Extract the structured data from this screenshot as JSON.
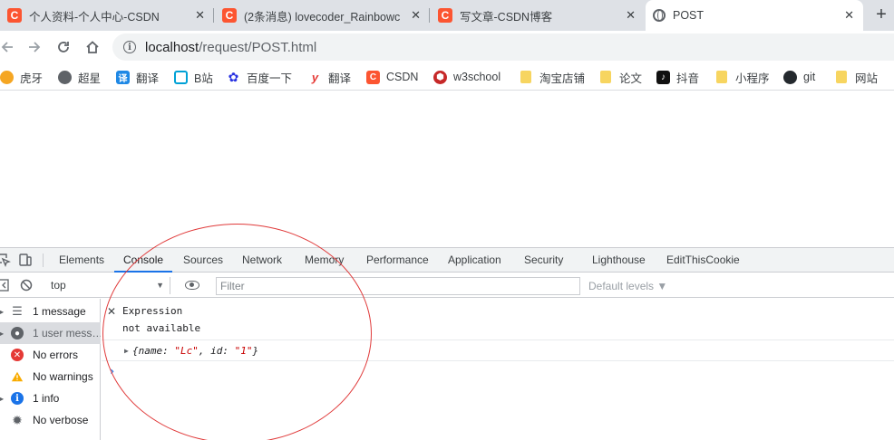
{
  "tabs": [
    {
      "title": "个人资料-个人中心-CSDN",
      "favicon": "csdn-icon",
      "active": false
    },
    {
      "title": "(2条消息) lovecoder_Rainbowc",
      "favicon": "csdn-icon",
      "active": false
    },
    {
      "title": "写文章-CSDN博客",
      "favicon": "csdn-icon",
      "active": false
    },
    {
      "title": "POST",
      "favicon": "globe-icon",
      "active": true
    }
  ],
  "tab_close_glyph": "✕",
  "new_tab_glyph": "+",
  "address": {
    "host": "localhost",
    "path": "/request/POST.html"
  },
  "bookmarks": [
    {
      "label": "虎牙",
      "icon": "huya-icon",
      "color": "#f5a623",
      "glyph": "虎"
    },
    {
      "label": "超星",
      "icon": "globe-icon",
      "color": "#5f6368",
      "glyph": "◉"
    },
    {
      "label": "翻译",
      "icon": "translate-icon",
      "color": "#1e88e5",
      "glyph": "译"
    },
    {
      "label": "B站",
      "icon": "bilibili-icon",
      "color": "#00a1d6",
      "glyph": "▣"
    },
    {
      "label": "百度一下",
      "icon": "baidu-icon",
      "color": "#2932e1",
      "glyph": "✿"
    },
    {
      "label": "翻译",
      "icon": "youdao-icon",
      "color": "#e53935",
      "glyph": "y"
    },
    {
      "label": "CSDN",
      "icon": "csdn-icon",
      "color": "#fc5531",
      "glyph": "C"
    },
    {
      "label": "w3school",
      "icon": "w3school-icon",
      "color": "#c62828",
      "glyph": "⬢"
    },
    {
      "label": "淘宝店铺",
      "icon": "folder-icon",
      "color": "#f7d560",
      "glyph": ""
    },
    {
      "label": "论文",
      "icon": "folder-icon",
      "color": "#f7d560",
      "glyph": ""
    },
    {
      "label": "抖音",
      "icon": "douyin-icon",
      "color": "#111111",
      "glyph": "♪"
    },
    {
      "label": "小程序",
      "icon": "folder-icon",
      "color": "#f7d560",
      "glyph": ""
    },
    {
      "label": "git",
      "icon": "github-icon",
      "color": "#24292e",
      "glyph": "●"
    },
    {
      "label": "网站",
      "icon": "folder-icon",
      "color": "#f7d560",
      "glyph": ""
    }
  ],
  "devtools": {
    "tabs": [
      "Elements",
      "Console",
      "Sources",
      "Network",
      "Memory",
      "Performance",
      "Application",
      "Security",
      "Lighthouse",
      "EditThisCookie"
    ],
    "active_tab": "Console",
    "context": "top",
    "filter_placeholder": "Filter",
    "levels": "Default levels ▼",
    "sidebar": [
      {
        "label": "1 message",
        "icon": "list-icon",
        "selected": false
      },
      {
        "label": "1 user mess…",
        "icon": "user-icon",
        "selected": true
      },
      {
        "label": "No errors",
        "icon": "error-icon",
        "selected": false
      },
      {
        "label": "No warnings",
        "icon": "warning-icon",
        "selected": false
      },
      {
        "label": "1 info",
        "icon": "info-icon",
        "selected": false
      },
      {
        "label": "No verbose",
        "icon": "verbose-icon",
        "selected": false
      }
    ],
    "expression": {
      "label": "Expression",
      "value": "not available"
    },
    "log": {
      "open": "{name: ",
      "name_value": "\"Lc\"",
      "mid": ", id: ",
      "id_value": "\"1\"",
      "close": "}"
    }
  }
}
